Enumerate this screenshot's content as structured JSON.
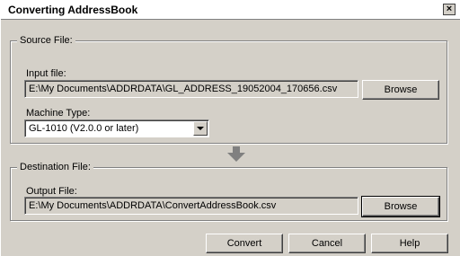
{
  "window": {
    "title": "Converting AddressBook",
    "close_glyph": "×"
  },
  "source": {
    "group_label": "Source File:",
    "input_label": "Input file:",
    "input_value": "E:\\My Documents\\ADDRDATA\\GL_ADDRESS_19052004_170656.csv",
    "browse_label": "Browse",
    "machine_label": "Machine Type:",
    "machine_value": "GL-1010 (V2.0.0 or later)"
  },
  "destination": {
    "group_label": "Destination File:",
    "output_label": "Output File:",
    "output_value": "E:\\My Documents\\ADDRDATA\\ConvertAddressBook.csv",
    "browse_label": "Browse"
  },
  "footer": {
    "convert_label": "Convert",
    "cancel_label": "Cancel",
    "help_label": "Help"
  },
  "icons": {
    "arrow": "down-arrow-icon",
    "close": "close-icon",
    "dropdown": "chevron-down-icon"
  }
}
